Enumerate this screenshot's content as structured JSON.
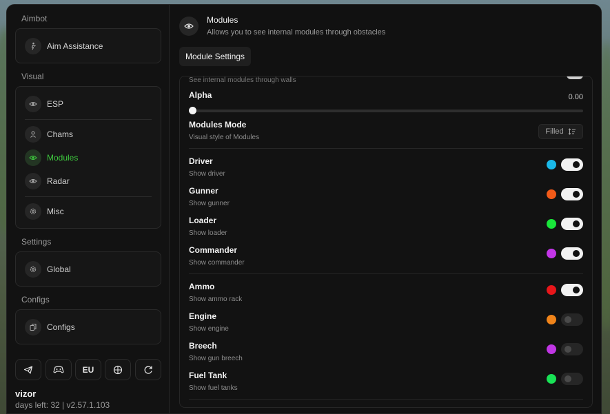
{
  "sidebar": {
    "sections": {
      "aimbot": "Aimbot",
      "visual": "Visual",
      "settings": "Settings",
      "configs": "Configs"
    },
    "items": {
      "aim_assistance": "Aim Assistance",
      "esp": "ESP",
      "chams": "Chams",
      "modules": "Modules",
      "radar": "Radar",
      "misc": "Misc",
      "global": "Global",
      "configs": "Configs"
    },
    "active": "modules",
    "region_button": "EU",
    "footer": {
      "username": "vizor",
      "subinfo": "days left: 32 | v2.57.1.103"
    }
  },
  "header": {
    "title": "Modules",
    "subtitle": "Allows you to see internal modules through obstacles",
    "tab": "Module Settings"
  },
  "settings": {
    "ghost_text": "See internal modules through walls",
    "alpha": {
      "label": "Alpha",
      "value": "0.00",
      "fraction": 0.0
    },
    "mode": {
      "label": "Modules Mode",
      "sub": "Visual style of Modules",
      "value": "Filled"
    }
  },
  "modules": [
    {
      "name": "Driver",
      "desc": "Show driver",
      "color": "#1ab8e8",
      "enabled": true
    },
    {
      "name": "Gunner",
      "desc": "Show gunner",
      "color": "#f25a18",
      "enabled": true
    },
    {
      "name": "Loader",
      "desc": "Show loader",
      "color": "#19e63a",
      "enabled": true
    },
    {
      "name": "Commander",
      "desc": "Show commander",
      "color": "#c335e8",
      "enabled": true
    },
    {
      "name": "Ammo",
      "desc": "Show ammo rack",
      "color": "#e8161a",
      "enabled": true
    },
    {
      "name": "Engine",
      "desc": "Show engine",
      "color": "#f0841a",
      "enabled": false
    },
    {
      "name": "Breech",
      "desc": "Show gun breech",
      "color": "#c036e4",
      "enabled": false
    },
    {
      "name": "Fuel Tank",
      "desc": "Show fuel tanks",
      "color": "#19e256",
      "enabled": false
    }
  ]
}
